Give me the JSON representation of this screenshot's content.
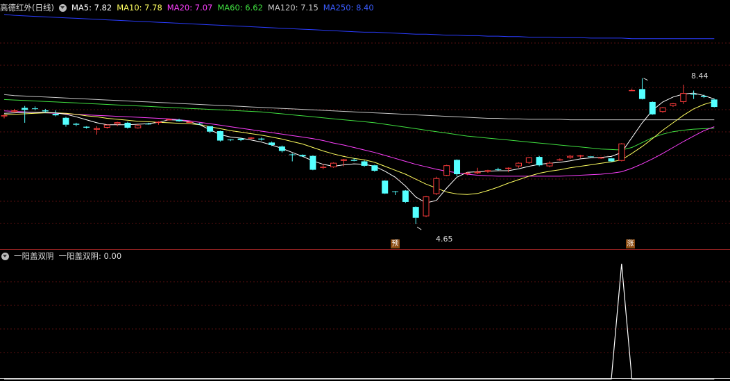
{
  "main_header": {
    "title": "高德红外(日线)",
    "ma5": "MA5: 7.82",
    "ma10": "MA10: 7.78",
    "ma20": "MA20: 7.07",
    "ma60": "MA60: 6.62",
    "ma120": "MA120: 7.15",
    "ma250": "MA250: 8.40"
  },
  "sub_header": {
    "title": "一阳盖双阴",
    "label": "一阳盖双阴: 0.00"
  },
  "colors": {
    "up": "#ff3c3c",
    "down": "#54ffff",
    "ma5": "#ffffff",
    "ma10": "#ffff60",
    "ma20": "#ff40ff",
    "ma60": "#40e040",
    "ma120": "#c8c8c8",
    "ma250": "#2a3cff",
    "grid": "#5a1010",
    "divider": "#8a2020",
    "signal": "#ffffff"
  },
  "annotations": {
    "low": "4.65",
    "high": "8.44",
    "badge1": "预",
    "badge2": "涨"
  },
  "chart_data": [
    {
      "type": "candlestick",
      "title": "高德红外(日线)",
      "ylim": [
        4.3,
        8.9
      ],
      "candles": [
        [
          6.83,
          6.87,
          6.79,
          6.85
        ],
        [
          6.92,
          6.98,
          6.9,
          6.95
        ],
        [
          7.0,
          7.04,
          6.7,
          6.96
        ],
        [
          6.99,
          7.03,
          6.95,
          6.98
        ],
        [
          6.95,
          6.98,
          6.9,
          6.93
        ],
        [
          6.88,
          6.95,
          6.83,
          6.85
        ],
        [
          6.8,
          6.82,
          6.62,
          6.66
        ],
        [
          6.68,
          6.7,
          6.63,
          6.66
        ],
        [
          6.62,
          6.63,
          6.58,
          6.6
        ],
        [
          6.56,
          6.63,
          6.46,
          6.59
        ],
        [
          6.6,
          6.67,
          6.58,
          6.66
        ],
        [
          6.67,
          6.72,
          6.63,
          6.71
        ],
        [
          6.7,
          6.72,
          6.58,
          6.6
        ],
        [
          6.59,
          6.67,
          6.58,
          6.65
        ],
        [
          6.68,
          6.7,
          6.66,
          6.67
        ],
        [
          6.7,
          6.73,
          6.66,
          6.72
        ],
        [
          6.76,
          6.78,
          6.75,
          6.77
        ],
        [
          6.76,
          6.78,
          6.72,
          6.73
        ],
        [
          6.72,
          6.73,
          6.71,
          6.72
        ],
        [
          6.68,
          6.7,
          6.66,
          6.67
        ],
        [
          6.63,
          6.63,
          6.49,
          6.52
        ],
        [
          6.53,
          6.54,
          6.32,
          6.34
        ],
        [
          6.36,
          6.37,
          6.33,
          6.35
        ],
        [
          6.38,
          6.39,
          6.33,
          6.35
        ],
        [
          6.39,
          6.41,
          6.37,
          6.4
        ],
        [
          6.38,
          6.4,
          6.34,
          6.36
        ],
        [
          6.3,
          6.32,
          6.23,
          6.25
        ],
        [
          6.22,
          6.24,
          6.1,
          6.13
        ],
        [
          6.06,
          6.08,
          5.92,
          6.05
        ],
        [
          6.05,
          6.06,
          6.01,
          6.02
        ],
        [
          6.03,
          6.04,
          5.74,
          5.75
        ],
        [
          5.79,
          5.87,
          5.76,
          5.81
        ],
        [
          5.8,
          5.9,
          5.79,
          5.89
        ],
        [
          5.93,
          5.97,
          5.82,
          5.96
        ],
        [
          5.95,
          5.98,
          5.92,
          5.93
        ],
        [
          5.92,
          5.94,
          5.81,
          5.83
        ],
        [
          5.84,
          5.85,
          5.71,
          5.73
        ],
        [
          5.53,
          5.54,
          5.26,
          5.27
        ],
        [
          5.31,
          5.32,
          5.24,
          5.3
        ],
        [
          5.33,
          5.34,
          5.08,
          5.1
        ],
        [
          5.0,
          5.01,
          4.65,
          4.78
        ],
        [
          4.81,
          5.22,
          4.79,
          5.21
        ],
        [
          5.26,
          5.61,
          5.24,
          5.58
        ],
        [
          5.63,
          5.85,
          5.62,
          5.84
        ],
        [
          5.95,
          5.96,
          5.62,
          5.66
        ],
        [
          5.67,
          5.7,
          5.64,
          5.69
        ],
        [
          5.68,
          5.79,
          5.66,
          5.71
        ],
        [
          5.71,
          5.75,
          5.69,
          5.74
        ],
        [
          5.76,
          5.79,
          5.73,
          5.75
        ],
        [
          5.77,
          5.8,
          5.7,
          5.79
        ],
        [
          5.82,
          5.9,
          5.79,
          5.89
        ],
        [
          5.89,
          6.01,
          5.87,
          6.0
        ],
        [
          6.01,
          6.03,
          5.82,
          5.84
        ],
        [
          5.82,
          5.92,
          5.8,
          5.89
        ],
        [
          5.94,
          5.98,
          5.93,
          5.96
        ],
        [
          5.99,
          6.05,
          5.97,
          6.03
        ],
        [
          6.02,
          6.05,
          5.99,
          6.04
        ],
        [
          6.02,
          6.02,
          6.0,
          6.01
        ],
        [
          5.99,
          6.01,
          5.97,
          6.0
        ],
        [
          5.98,
          5.99,
          5.91,
          5.92
        ],
        [
          5.93,
          6.29,
          5.92,
          6.28
        ],
        [
          7.35,
          7.39,
          7.35,
          7.36
        ],
        [
          7.38,
          7.6,
          7.17,
          7.18
        ],
        [
          7.12,
          7.13,
          6.86,
          6.87
        ],
        [
          6.92,
          7.02,
          6.9,
          7.01
        ],
        [
          7.04,
          7.1,
          7.02,
          7.09
        ],
        [
          7.12,
          7.47,
          7.08,
          7.3
        ],
        [
          7.28,
          7.35,
          7.18,
          7.27
        ],
        [
          7.24,
          7.27,
          7.2,
          7.22
        ],
        [
          7.17,
          7.19,
          7.01,
          7.02
        ]
      ],
      "ma5": [
        6.89,
        6.9,
        6.91,
        6.91,
        6.91,
        6.9,
        6.87,
        6.82,
        6.76,
        6.7,
        6.66,
        6.66,
        6.66,
        6.67,
        6.68,
        6.71,
        6.76,
        6.75,
        6.72,
        6.66,
        6.56,
        6.46,
        6.41,
        6.39,
        6.35,
        6.31,
        6.25,
        6.18,
        6.1,
        6.02,
        5.93,
        5.86,
        5.82,
        5.85,
        5.87,
        5.86,
        5.82,
        5.72,
        5.6,
        5.42,
        5.2,
        5.08,
        5.13,
        5.38,
        5.6,
        5.7,
        5.71,
        5.72,
        5.73,
        5.73,
        5.77,
        5.82,
        5.86,
        5.88,
        5.9,
        5.93,
        5.97,
        5.99,
        6.0,
        6.02,
        6.1,
        6.4,
        6.7,
        6.95,
        7.12,
        7.22,
        7.28,
        7.3,
        7.25,
        7.18
      ],
      "ma10": [
        6.86,
        6.87,
        6.88,
        6.89,
        6.9,
        6.9,
        6.89,
        6.87,
        6.84,
        6.82,
        6.79,
        6.77,
        6.75,
        6.73,
        6.72,
        6.71,
        6.7,
        6.69,
        6.68,
        6.66,
        6.62,
        6.58,
        6.54,
        6.51,
        6.48,
        6.45,
        6.41,
        6.37,
        6.32,
        6.27,
        6.2,
        6.13,
        6.07,
        6.02,
        5.98,
        5.95,
        5.9,
        5.82,
        5.74,
        5.66,
        5.56,
        5.46,
        5.38,
        5.3,
        5.26,
        5.25,
        5.27,
        5.33,
        5.4,
        5.48,
        5.55,
        5.62,
        5.68,
        5.72,
        5.75,
        5.79,
        5.82,
        5.85,
        5.88,
        5.91,
        5.95,
        6.08,
        6.22,
        6.38,
        6.55,
        6.7,
        6.85,
        6.98,
        7.07,
        7.13
      ],
      "ma20": [
        6.94,
        6.93,
        6.92,
        6.91,
        6.9,
        6.89,
        6.88,
        6.87,
        6.86,
        6.85,
        6.84,
        6.83,
        6.82,
        6.81,
        6.8,
        6.79,
        6.78,
        6.76,
        6.74,
        6.71,
        6.68,
        6.65,
        6.62,
        6.59,
        6.56,
        6.53,
        6.5,
        6.47,
        6.44,
        6.41,
        6.38,
        6.34,
        6.29,
        6.25,
        6.2,
        6.15,
        6.1,
        6.04,
        5.98,
        5.92,
        5.86,
        5.81,
        5.76,
        5.72,
        5.69,
        5.66,
        5.64,
        5.63,
        5.62,
        5.62,
        5.62,
        5.62,
        5.62,
        5.62,
        5.62,
        5.63,
        5.64,
        5.65,
        5.66,
        5.68,
        5.71,
        5.78,
        5.87,
        5.97,
        6.08,
        6.2,
        6.32,
        6.43,
        6.54,
        6.62
      ],
      "ma60": [
        7.17,
        7.16,
        7.15,
        7.14,
        7.13,
        7.12,
        7.11,
        7.1,
        7.09,
        7.08,
        7.07,
        7.06,
        7.05,
        7.04,
        7.03,
        7.02,
        7.01,
        7.0,
        6.99,
        6.98,
        6.97,
        6.96,
        6.95,
        6.94,
        6.93,
        6.92,
        6.9,
        6.88,
        6.86,
        6.84,
        6.82,
        6.8,
        6.78,
        6.76,
        6.74,
        6.72,
        6.7,
        6.67,
        6.64,
        6.61,
        6.58,
        6.55,
        6.52,
        6.49,
        6.46,
        6.43,
        6.41,
        6.39,
        6.37,
        6.35,
        6.33,
        6.31,
        6.29,
        6.27,
        6.25,
        6.23,
        6.21,
        6.19,
        6.17,
        6.16,
        6.15,
        6.2,
        6.3,
        6.4,
        6.47,
        6.52,
        6.55,
        6.57,
        6.58,
        6.59
      ],
      "ma120": [
        7.27,
        7.25,
        7.24,
        7.23,
        7.22,
        7.21,
        7.2,
        7.19,
        7.18,
        7.17,
        7.16,
        7.15,
        7.14,
        7.13,
        7.12,
        7.11,
        7.1,
        7.09,
        7.08,
        7.07,
        7.06,
        7.05,
        7.04,
        7.03,
        7.02,
        7.01,
        7.0,
        6.99,
        6.98,
        6.97,
        6.96,
        6.95,
        6.94,
        6.93,
        6.92,
        6.91,
        6.9,
        6.89,
        6.88,
        6.87,
        6.86,
        6.85,
        6.84,
        6.83,
        6.82,
        6.81,
        6.8,
        6.79,
        6.79,
        6.78,
        6.78,
        6.77,
        6.77,
        6.77,
        6.77,
        6.76,
        6.76,
        6.76,
        6.76,
        6.76,
        6.76,
        6.76,
        6.76,
        6.76,
        6.76,
        6.76,
        6.76,
        6.76,
        6.76,
        6.76
      ],
      "ma250": [
        8.89,
        8.87,
        8.86,
        8.85,
        8.84,
        8.83,
        8.82,
        8.81,
        8.8,
        8.79,
        8.78,
        8.77,
        8.76,
        8.75,
        8.74,
        8.73,
        8.72,
        8.71,
        8.7,
        8.69,
        8.68,
        8.67,
        8.66,
        8.65,
        8.64,
        8.63,
        8.62,
        8.61,
        8.6,
        8.59,
        8.58,
        8.57,
        8.56,
        8.55,
        8.54,
        8.53,
        8.53,
        8.52,
        8.51,
        8.5,
        8.49,
        8.49,
        8.48,
        8.47,
        8.47,
        8.46,
        8.46,
        8.45,
        8.45,
        8.44,
        8.44,
        8.43,
        8.43,
        8.43,
        8.42,
        8.42,
        8.42,
        8.41,
        8.41,
        8.41,
        8.41,
        8.4,
        8.4,
        8.4,
        8.4,
        8.4,
        8.4,
        8.4,
        8.4,
        8.4
      ]
    },
    {
      "type": "line",
      "title": "一阳盖双阴",
      "series": [
        {
          "name": "一阳盖双阴",
          "values": [
            0,
            0,
            0,
            0,
            0,
            0,
            0,
            0,
            0,
            0,
            0,
            0,
            0,
            0,
            0,
            0,
            0,
            0,
            0,
            0,
            0,
            0,
            0,
            0,
            0,
            0,
            0,
            0,
            0,
            0,
            0,
            0,
            0,
            0,
            0,
            0,
            0,
            0,
            0,
            0,
            0,
            0,
            0,
            0,
            0,
            0,
            0,
            0,
            0,
            0,
            0,
            0,
            0,
            0,
            0,
            0,
            0,
            0,
            0,
            0,
            1,
            0,
            0,
            0,
            0,
            0,
            0,
            0,
            0,
            0
          ]
        }
      ],
      "ylim": [
        0,
        1
      ]
    }
  ]
}
